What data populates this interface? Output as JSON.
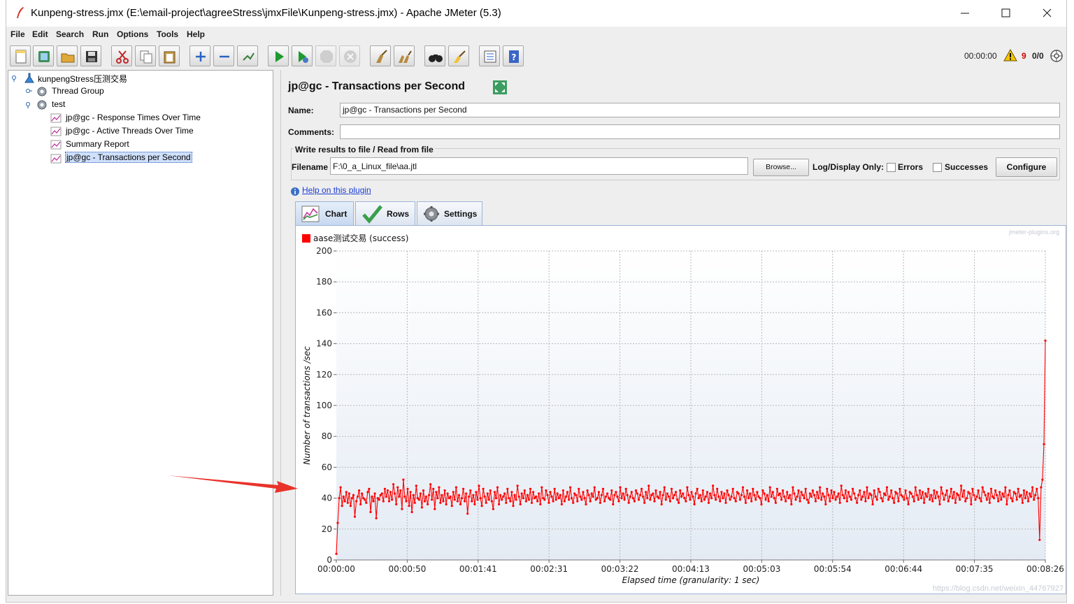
{
  "window": {
    "title": "Kunpeng-stress.jmx (E:\\email-project\\agreeStress\\jmxFile\\Kunpeng-stress.jmx) - Apache JMeter (5.3)",
    "minimize_icon": "minimize-icon",
    "maximize_icon": "maximize-icon",
    "close_icon": "close-icon"
  },
  "menubar": [
    "File",
    "Edit",
    "Search",
    "Run",
    "Options",
    "Tools",
    "Help"
  ],
  "toolbar": {
    "buttons": [
      "new",
      "templates",
      "open",
      "save",
      "cut",
      "copy",
      "paste",
      "expand",
      "collapse",
      "toggle",
      "start",
      "start-no-pauses",
      "stop",
      "shutdown",
      "clear",
      "clear-all",
      "search",
      "reset-search",
      "function-helper",
      "help"
    ],
    "timer": "00:00:00",
    "warnings": "9",
    "threads": "0/0"
  },
  "tree": {
    "root": "kunpengStress压测交易",
    "items": [
      {
        "label": "Thread Group",
        "icon": "gear-icon"
      },
      {
        "label": "test",
        "icon": "gear-icon"
      },
      {
        "label": "jp@gc - Response Times Over Time",
        "icon": "graph-icon"
      },
      {
        "label": "jp@gc - Active Threads Over Time",
        "icon": "graph-icon"
      },
      {
        "label": "Summary Report",
        "icon": "graph-icon"
      },
      {
        "label": "jp@gc - Transactions per Second",
        "icon": "graph-icon",
        "selected": true
      }
    ]
  },
  "panel": {
    "title": "jp@gc - Transactions per Second",
    "name_label": "Name:",
    "name_value": "jp@gc - Transactions per Second",
    "comments_label": "Comments:",
    "comments_value": "",
    "file_group_title": "Write results to file / Read from file",
    "filename_label": "Filename",
    "filename_value": "F:\\0_a_Linux_file\\aa.jtl",
    "browse_label": "Browse...",
    "log_display_label": "Log/Display Only:",
    "errors_label": "Errors",
    "successes_label": "Successes",
    "configure_label": "Configure",
    "help_link": "Help on this plugin",
    "tabs": [
      {
        "label": "Chart",
        "active": true
      },
      {
        "label": "Rows",
        "active": false
      },
      {
        "label": "Settings",
        "active": false
      }
    ],
    "watermark": "jmeter-plugins.org",
    "blog_watermark": "https://blog.csdn.net/weixin_44767927"
  },
  "chart_data": {
    "type": "line",
    "title": "",
    "xlabel": "Elapsed time (granularity: 1 sec)",
    "ylabel": "Number of transactions /sec",
    "ylim": [
      0,
      200
    ],
    "xlim": [
      0,
      506
    ],
    "yticks": [
      "0",
      "20",
      "40",
      "60",
      "80",
      "100",
      "120",
      "140",
      "160",
      "180",
      "200"
    ],
    "xticks": [
      "00:00:00",
      "00:00:50",
      "00:01:41",
      "00:02:31",
      "00:03:22",
      "00:04:13",
      "00:05:03",
      "00:05:54",
      "00:06:44",
      "00:07:35",
      "00:08:26"
    ],
    "grid": true,
    "legend_position": "top-left",
    "series": [
      {
        "name": "aase测试交易 (success)",
        "color": "#ff0000",
        "values": [
          4,
          24,
          40,
          47,
          35,
          41,
          38,
          44,
          37,
          43,
          35,
          40,
          42,
          28,
          38,
          41,
          45,
          36,
          43,
          40,
          39,
          37,
          44,
          46,
          31,
          41,
          38,
          43,
          27,
          40,
          39,
          42,
          43,
          38,
          46,
          41,
          45,
          38,
          44,
          39,
          49,
          43,
          36,
          47,
          41,
          45,
          33,
          52,
          41,
          38,
          46,
          35,
          44,
          31,
          42,
          37,
          48,
          40,
          39,
          43,
          34,
          45,
          38,
          41,
          36,
          42,
          49,
          39,
          46,
          33,
          44,
          40,
          47,
          37,
          42,
          38,
          45,
          36,
          43,
          40,
          41,
          35,
          44,
          39,
          47,
          38,
          42,
          36,
          40,
          46,
          38,
          43,
          30,
          41,
          45,
          38,
          42,
          36,
          44,
          39,
          48,
          40,
          35,
          46,
          41,
          37,
          43,
          39,
          45,
          38,
          33,
          44,
          40,
          47,
          36,
          42,
          39,
          41,
          43,
          37,
          46,
          40,
          38,
          44,
          35,
          42,
          39,
          48,
          41,
          36,
          43,
          40,
          45,
          38,
          42,
          39,
          46,
          37,
          44,
          40,
          41,
          38,
          43,
          36,
          47,
          40,
          39,
          45,
          42,
          37,
          44,
          41,
          38,
          46,
          39,
          43,
          40,
          42,
          36,
          45,
          38,
          41,
          44,
          39,
          47,
          40,
          37,
          43,
          42,
          38,
          46,
          41,
          39,
          44,
          40,
          36,
          45,
          42,
          38,
          43,
          41,
          47,
          39,
          40,
          44,
          37,
          42,
          46,
          38,
          41,
          43,
          40,
          39,
          45,
          36,
          42,
          44,
          41,
          38,
          47,
          40,
          43,
          39,
          46,
          42,
          37,
          41,
          44,
          40,
          38,
          45,
          43,
          39,
          42,
          46,
          41,
          37,
          44,
          40,
          48,
          39,
          42,
          43,
          38,
          45,
          41,
          40,
          44,
          36,
          42,
          47,
          39,
          43,
          41,
          38,
          46,
          40,
          42,
          44,
          39,
          37,
          45,
          41,
          43,
          40,
          38,
          47,
          42,
          39,
          44,
          41,
          36,
          43,
          46,
          40,
          42,
          38,
          45,
          39,
          41,
          44,
          37,
          43,
          40,
          48,
          42,
          39,
          46,
          41,
          38,
          44,
          40,
          43,
          37,
          45,
          42,
          39,
          41,
          46,
          40,
          38,
          44,
          43,
          39,
          42,
          47,
          41,
          37,
          45,
          40,
          43,
          38,
          46,
          42,
          39,
          44,
          41,
          40,
          36,
          45,
          43,
          39,
          42,
          38,
          47,
          41,
          44,
          40,
          37,
          46,
          42,
          43,
          39,
          45,
          41,
          38,
          44,
          40,
          42,
          36,
          47,
          43,
          39,
          41,
          45,
          38,
          44,
          42,
          40,
          46,
          39,
          37,
          43,
          41,
          45,
          42,
          38,
          44,
          40,
          47,
          39,
          43,
          41,
          36,
          46,
          42,
          38,
          45,
          40,
          44,
          39,
          41,
          43,
          37,
          48,
          42,
          40,
          45,
          38,
          44,
          41,
          39,
          46,
          43,
          40,
          37,
          42,
          45,
          39,
          41,
          44,
          38,
          47,
          40,
          43,
          42,
          36,
          45,
          41,
          39,
          46,
          44,
          40,
          38,
          43,
          42,
          47,
          39,
          41,
          45,
          40,
          37,
          44,
          43,
          38,
          46,
          42,
          41,
          39,
          45,
          40,
          36,
          44,
          43,
          41,
          38,
          47,
          42,
          39,
          45,
          40,
          44,
          37,
          43,
          41,
          46,
          39,
          42,
          38,
          45,
          40,
          44,
          41,
          36,
          47,
          43,
          39,
          42,
          45,
          38,
          41,
          46,
          40,
          44,
          37,
          43,
          42,
          39,
          48,
          41,
          45,
          38,
          40,
          44,
          43,
          36,
          46,
          42,
          39,
          41,
          45,
          40,
          38,
          47,
          44,
          42,
          39,
          43,
          37,
          46,
          41,
          40,
          45,
          42,
          38,
          44,
          39,
          43,
          41,
          47,
          36,
          42,
          45,
          40,
          38,
          44,
          43,
          39,
          46,
          41,
          42,
          37,
          45,
          40,
          44,
          38,
          43,
          41,
          47,
          39,
          42,
          46,
          40,
          13,
          47,
          52,
          75,
          142
        ]
      }
    ]
  }
}
